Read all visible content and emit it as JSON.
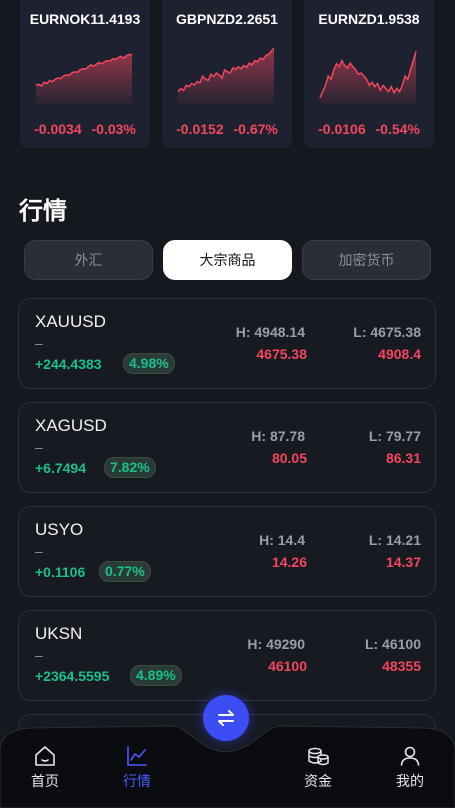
{
  "tickers": [
    {
      "symbol": "EURNOK11.4193",
      "change": "-0.0034",
      "percent": "-0.03%",
      "spark": [
        0.3,
        0.32,
        0.29,
        0.35,
        0.33,
        0.38,
        0.36,
        0.4,
        0.42,
        0.41,
        0.45,
        0.47,
        0.46,
        0.5,
        0.52,
        0.51,
        0.55,
        0.57,
        0.56,
        0.6,
        0.63,
        0.61,
        0.64,
        0.67,
        0.65,
        0.68,
        0.7,
        0.69,
        0.73,
        0.72,
        0.75,
        0.77,
        0.74,
        0.78,
        0.8,
        0.79
      ]
    },
    {
      "symbol": "GBPNZD2.2651",
      "change": "-0.0152",
      "percent": "-0.67%",
      "spark": [
        0.2,
        0.25,
        0.22,
        0.3,
        0.28,
        0.33,
        0.31,
        0.36,
        0.34,
        0.45,
        0.4,
        0.38,
        0.48,
        0.44,
        0.5,
        0.47,
        0.42,
        0.55,
        0.52,
        0.5,
        0.58,
        0.56,
        0.6,
        0.57,
        0.62,
        0.59,
        0.66,
        0.63,
        0.7,
        0.68,
        0.74,
        0.72,
        0.78,
        0.8,
        0.85,
        0.9
      ]
    },
    {
      "symbol": "EURNZD1.9538",
      "change": "-0.0106",
      "percent": "-0.54%",
      "spark": [
        0.1,
        0.2,
        0.3,
        0.45,
        0.4,
        0.55,
        0.65,
        0.6,
        0.7,
        0.62,
        0.58,
        0.66,
        0.6,
        0.55,
        0.48,
        0.5,
        0.45,
        0.4,
        0.3,
        0.35,
        0.28,
        0.33,
        0.22,
        0.3,
        0.25,
        0.2,
        0.28,
        0.18,
        0.25,
        0.2,
        0.3,
        0.45,
        0.4,
        0.55,
        0.7,
        0.85
      ]
    }
  ],
  "section_title": "行情",
  "tabs": [
    "外汇",
    "大宗商品",
    "加密货币"
  ],
  "active_tab": 1,
  "instruments": [
    {
      "name": "XAUUSD",
      "dash": "–",
      "change": "+244.4383",
      "percent": "4.98%",
      "high_label": "H: 4948.14",
      "low_label": "L: 4675.38",
      "bid": "4675.38",
      "ask": "4908.4"
    },
    {
      "name": "XAGUSD",
      "dash": "–",
      "change": "+6.7494",
      "percent": "7.82%",
      "high_label": "H: 87.78",
      "low_label": "L: 79.77",
      "bid": "80.05",
      "ask": "86.31"
    },
    {
      "name": "USYO",
      "dash": "–",
      "change": "+0.1106",
      "percent": "0.77%",
      "high_label": "H: 14.4",
      "low_label": "L: 14.21",
      "bid": "14.26",
      "ask": "14.37"
    },
    {
      "name": "UKSN",
      "dash": "–",
      "change": "+2364.5595",
      "percent": "4.89%",
      "high_label": "H: 49290",
      "low_label": "L: 46100",
      "bid": "46100",
      "ask": "48355"
    }
  ],
  "nav": [
    {
      "label": "首页",
      "icon": "home-icon"
    },
    {
      "label": "行情",
      "icon": "chart-icon"
    },
    {
      "label": "资金",
      "icon": "coins-icon"
    },
    {
      "label": "我的",
      "icon": "user-icon"
    }
  ],
  "active_nav": 1,
  "colors": {
    "up": "#19c08d",
    "down": "#f2475e",
    "accent": "#4a5bff",
    "background": "#16181f"
  }
}
